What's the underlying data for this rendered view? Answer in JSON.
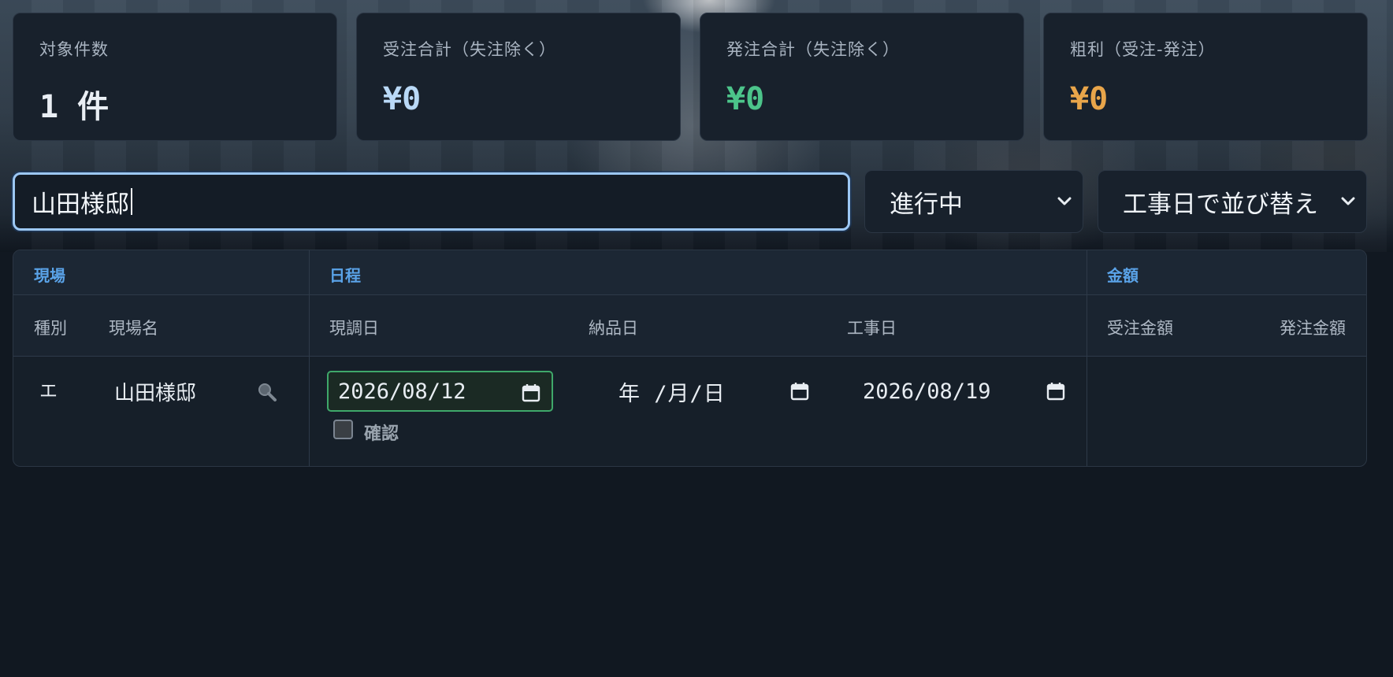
{
  "stats": [
    {
      "label": "対象件数",
      "value": "1 件",
      "color": "#e9eef4"
    },
    {
      "label": "受注合計（失注除く）",
      "value": "¥0",
      "color": "#b9d9f7"
    },
    {
      "label": "発注合計（失注除く）",
      "value": "¥0",
      "color": "#4cc48a"
    },
    {
      "label": "粗利（受注-発注）",
      "value": "¥0",
      "color": "#e8a54a"
    }
  ],
  "search": {
    "value": "山田様邸"
  },
  "filters": {
    "status": "進行中",
    "sort": "工事日で並び替え"
  },
  "table": {
    "groups": {
      "site": "現場",
      "schedule": "日程",
      "amount": "金額"
    },
    "columns": {
      "type": "種別",
      "site_name": "現場名",
      "survey_date": "現調日",
      "delivery_date": "納品日",
      "work_date": "工事日",
      "order_amount": "受注金額",
      "purchase_amount": "発注金額"
    },
    "rows": [
      {
        "type": "エ",
        "site_name": "山田様邸",
        "survey_date": "2026/08/12",
        "delivery_date": "年 /月/日",
        "work_date": "2026/08/19",
        "confirm_label": "確認",
        "confirmed": false
      }
    ]
  },
  "icons": {
    "search": "magnifier-icon",
    "calendar": "calendar-icon",
    "dropdown": "chevron-down-icon"
  }
}
